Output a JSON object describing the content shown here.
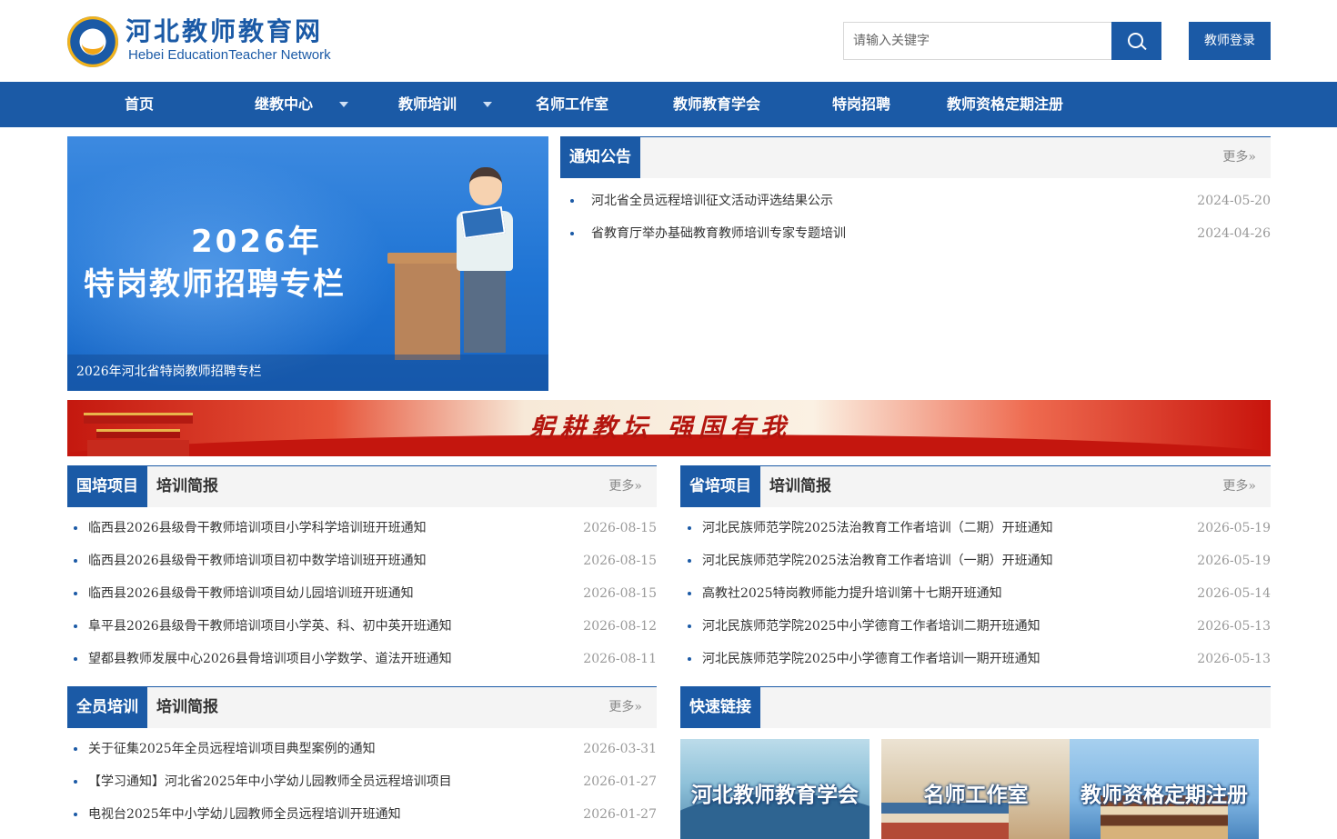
{
  "site": {
    "logo_cn": "河北教师教育网",
    "logo_en": "Hebei EducationTeacher  Network",
    "search_placeholder": "请输入关键字",
    "login_label": "教师登录"
  },
  "nav": {
    "items": [
      {
        "label": "首页"
      },
      {
        "label": "继教中心"
      },
      {
        "label": "教师培训"
      },
      {
        "label": "名师工作室"
      },
      {
        "label": "教师教育学会"
      },
      {
        "label": "特岗招聘"
      },
      {
        "label": "教师资格定期注册"
      }
    ]
  },
  "hero": {
    "year": "2026年",
    "title": "特岗教师招聘专栏",
    "caption": "2026年河北省特岗教师招聘专栏"
  },
  "notice": {
    "tag": "通知公告",
    "more": "更多»",
    "items": [
      {
        "title": "河北省全员远程培训征文活动评选结果公示",
        "date": "2024-05-20"
      },
      {
        "title": "省教育厅举办基础教育教师培训专家专题培训",
        "date": "2024-04-26"
      }
    ]
  },
  "banner": {
    "slogan": "躬耕教坛  强国有我"
  },
  "guopei": {
    "tag": "国培项目",
    "sub": "培训简报",
    "more": "更多»",
    "items": [
      {
        "title": "临西县2026县级骨干教师培训项目小学科学培训班开班通知",
        "date": "2026-08-15"
      },
      {
        "title": "临西县2026县级骨干教师培训项目初中数学培训班开班通知",
        "date": "2026-08-15"
      },
      {
        "title": "临西县2026县级骨干教师培训项目幼儿园培训班开班通知",
        "date": "2026-08-15"
      },
      {
        "title": "阜平县2026县级骨干教师培训项目小学英、科、初中英开班通知",
        "date": "2026-08-12"
      },
      {
        "title": "望都县教师发展中心2026县骨培训项目小学数学、道法开班通知",
        "date": "2026-08-11"
      }
    ]
  },
  "shengpei": {
    "tag": "省培项目",
    "sub": "培训简报",
    "more": "更多»",
    "items": [
      {
        "title": "河北民族师范学院2025法治教育工作者培训（二期）开班通知",
        "date": "2026-05-19"
      },
      {
        "title": "河北民族师范学院2025法治教育工作者培训（一期）开班通知",
        "date": "2026-05-19"
      },
      {
        "title": "高教社2025特岗教师能力提升培训第十七期开班通知",
        "date": "2026-05-14"
      },
      {
        "title": "河北民族师范学院2025中小学德育工作者培训二期开班通知",
        "date": "2026-05-13"
      },
      {
        "title": "河北民族师范学院2025中小学德育工作者培训一期开班通知",
        "date": "2026-05-13"
      }
    ]
  },
  "quanyuan": {
    "tag": "全员培训",
    "sub": "培训简报",
    "more": "更多»",
    "items": [
      {
        "title": "关于征集2025年全员远程培训项目典型案例的通知",
        "date": "2026-03-31"
      },
      {
        "title": "【学习通知】河北省2025年中小学幼儿园教师全员远程培训项目",
        "date": "2026-01-27"
      },
      {
        "title": "电视台2025年中小学幼儿园教师全员远程培训开班通知",
        "date": "2026-01-27"
      }
    ]
  },
  "quicklinks": {
    "tag": "快速链接",
    "items": [
      {
        "label": "河北教师教育学会"
      },
      {
        "label": "名师工作室"
      },
      {
        "label": "教师资格定期注册"
      }
    ]
  },
  "colors": {
    "primary": "#1b5aa6",
    "accent_red": "#c4180f",
    "date_gray": "#999999"
  }
}
